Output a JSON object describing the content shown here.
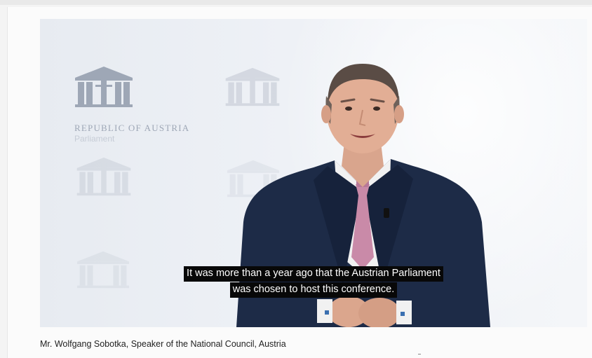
{
  "video": {
    "branding": {
      "title": "REPUBLIC OF AUSTRIA",
      "subtitle": "Parliament",
      "logo_icon": "parliament-building-icon"
    },
    "speaker_image": "speaker-in-suit",
    "subtitles": [
      "It was more than a year ago that the Austrian Parliament",
      "was chosen to host this conference."
    ]
  },
  "description": "Mr. Wolfgang Sobotka, Speaker of the National Council, Austria",
  "colors": {
    "page_bg": "#f4f4f4",
    "card_bg": "#fbfbfb",
    "video_bg": "#eef1f6",
    "caption_bg": "#080808",
    "caption_text": "#ffffff",
    "suit": "#1d2b47",
    "tie": "#c98aa8",
    "watermark": "#9ea7b6",
    "description_text": "#222222"
  }
}
